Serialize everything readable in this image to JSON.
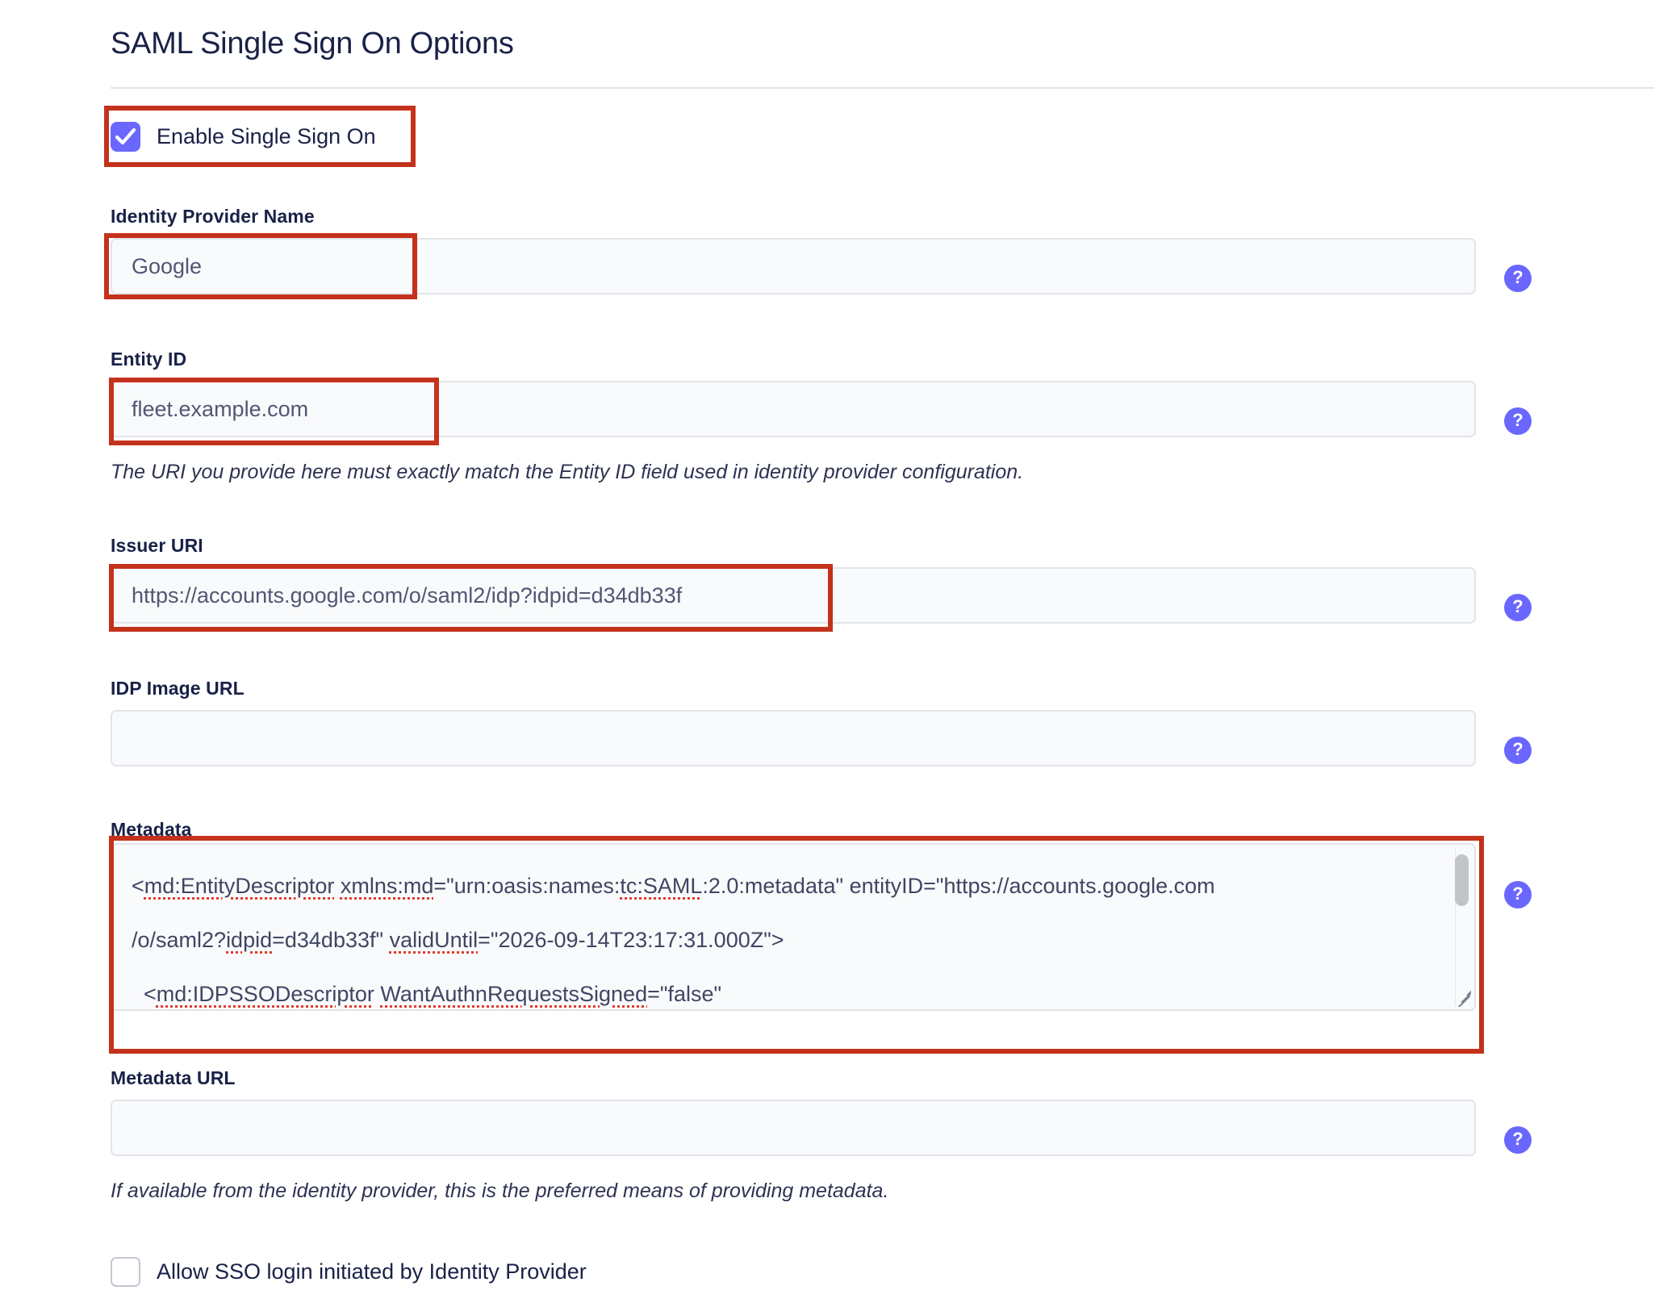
{
  "page": {
    "title": "SAML Single Sign On Options"
  },
  "enable_sso": {
    "label": "Enable Single Sign On",
    "checked": true,
    "checkbox_color": "#6a67fe"
  },
  "fields": {
    "identity_provider_name": {
      "label": "Identity Provider Name",
      "value": "Google",
      "help_icon": "question-mark-icon"
    },
    "entity_id": {
      "label": "Entity ID",
      "value": "fleet.example.com",
      "helper": "The URI you provide here must exactly match the Entity ID field used in identity provider configuration.",
      "help_icon": "question-mark-icon"
    },
    "issuer_uri": {
      "label": "Issuer URI",
      "value": "https://accounts.google.com/o/saml2/idp?idpid=d34db33f",
      "help_icon": "question-mark-icon"
    },
    "idp_image_url": {
      "label": "IDP Image URL",
      "value": "",
      "help_icon": "question-mark-icon"
    },
    "metadata": {
      "label": "Metadata",
      "help_icon": "question-mark-icon",
      "lines": [
        {
          "segments": [
            {
              "text": "<",
              "spell": false
            },
            {
              "text": "md:EntityDescriptor",
              "spell": true
            },
            {
              "text": " ",
              "spell": false
            },
            {
              "text": "xmlns:md",
              "spell": true
            },
            {
              "text": "=\"urn:oasis:names:",
              "spell": false
            },
            {
              "text": "tc:SAML",
              "spell": true
            },
            {
              "text": ":2.0:metadata\" entityID=\"https://accounts.google.com",
              "spell": false
            }
          ]
        },
        {
          "segments": [
            {
              "text": "/o/saml2?",
              "spell": false
            },
            {
              "text": "idpid",
              "spell": true
            },
            {
              "text": "=d34db33f\" ",
              "spell": false
            },
            {
              "text": "validUntil",
              "spell": true
            },
            {
              "text": "=\"2026-09-14T23:17:31.000Z\">",
              "spell": false
            }
          ]
        },
        {
          "segments": [
            {
              "text": "  <",
              "spell": false
            },
            {
              "text": "md:IDPSSODescriptor",
              "spell": true
            },
            {
              "text": " ",
              "spell": false
            },
            {
              "text": "WantAuthnRequestsSigned",
              "spell": true
            },
            {
              "text": "=\"false\"",
              "spell": false
            }
          ]
        }
      ]
    },
    "metadata_url": {
      "label": "Metadata URL",
      "value": "",
      "helper": "If available from the identity provider, this is the preferred means of providing metadata.",
      "help_icon": "question-mark-icon"
    }
  },
  "allow_sso_idp": {
    "label": "Allow SSO login initiated by Identity Provider",
    "checked": false
  },
  "annotations": {
    "color": "#c4321c",
    "boxes": [
      "enable-sso-row",
      "identity-provider-name-input",
      "entity-id-input",
      "issuer-uri-input",
      "metadata-textarea"
    ]
  }
}
